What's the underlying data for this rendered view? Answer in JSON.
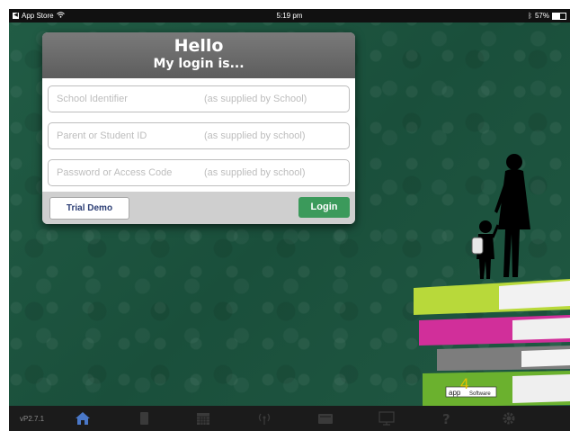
{
  "status_bar": {
    "back_app": "App Store",
    "time": "5:19 pm",
    "battery": "57%",
    "battery_level": 0.57
  },
  "login_panel": {
    "title": "Hello",
    "subtitle": "My login is...",
    "fields": [
      {
        "placeholder": "School Identifier",
        "hint": "(as supplied by School)"
      },
      {
        "placeholder": "Parent or Student ID",
        "hint": "(as supplied by school)"
      },
      {
        "placeholder": "Password or Access Code",
        "hint": "(as supplied by school)"
      }
    ],
    "trial_button": "Trial Demo",
    "login_button": "Login"
  },
  "branding": {
    "logo_text_1": "app",
    "logo_text_2": "4",
    "logo_text_3": "Software"
  },
  "tab_bar": {
    "version": "vP2.7.1",
    "tabs": [
      {
        "icon": "home-icon"
      },
      {
        "icon": "book-icon"
      },
      {
        "icon": "calendar-icon"
      },
      {
        "icon": "broadcast-icon"
      },
      {
        "icon": "inbox-icon"
      },
      {
        "icon": "presentation-icon"
      },
      {
        "icon": "help-icon"
      },
      {
        "icon": "gear-icon"
      }
    ]
  },
  "colors": {
    "background": "#1e5641",
    "login_green": "#3b9a5b",
    "trial_text": "#2c3e75",
    "active_tab": "#4a78c8"
  }
}
